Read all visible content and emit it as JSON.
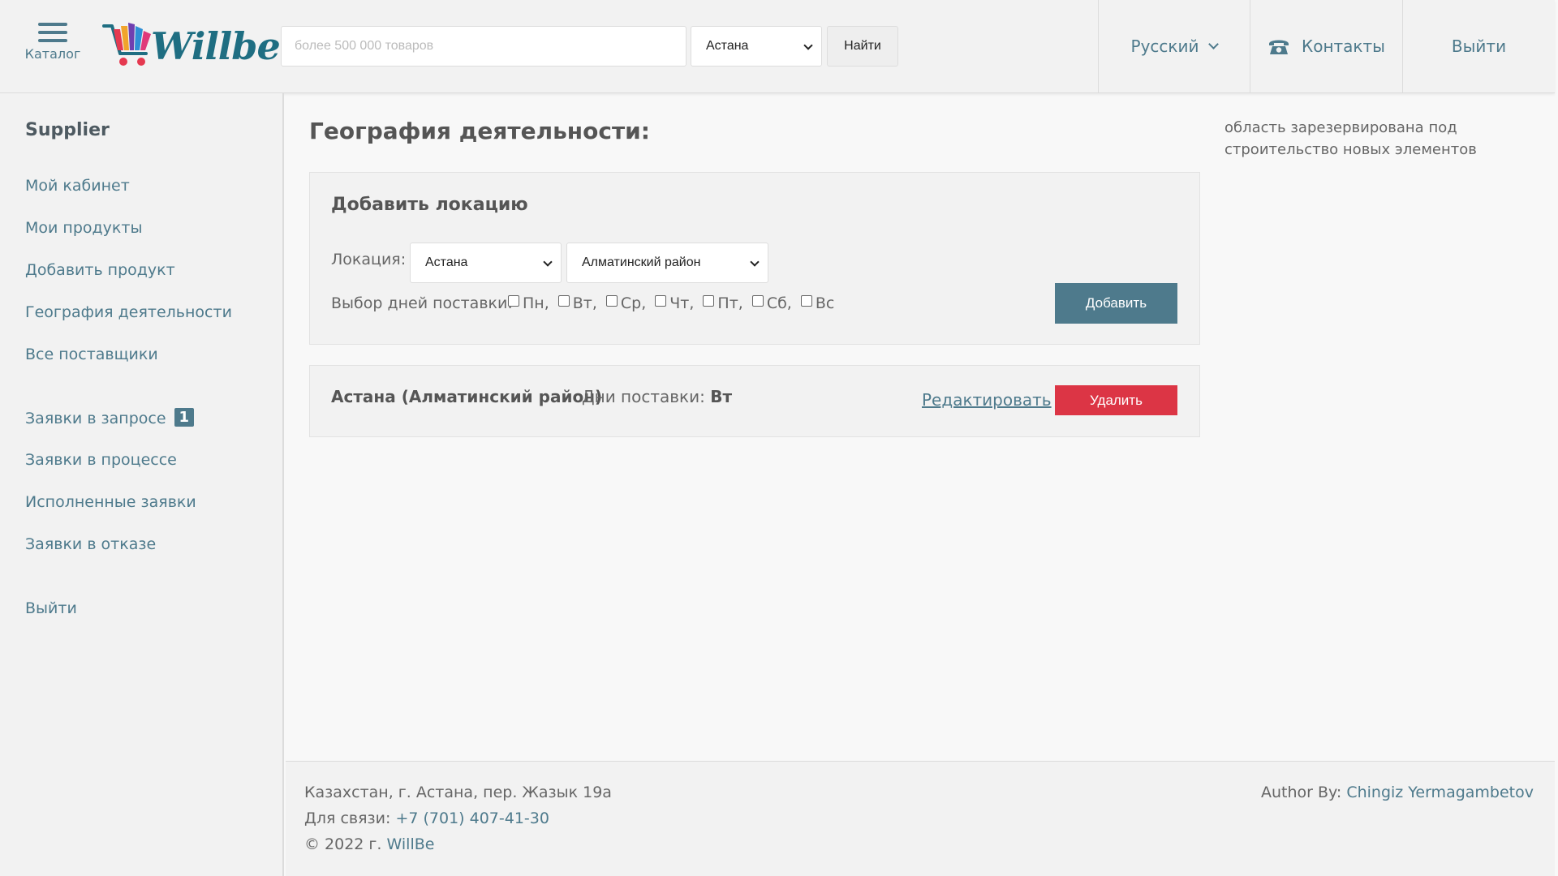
{
  "header": {
    "catalog_label": "Каталог",
    "logo_text": "Willbe",
    "search_placeholder": "более 500 000 товаров",
    "city_selected": "Астана",
    "find_label": "Найти",
    "language": "Русский",
    "contacts_label": "Контакты",
    "logout_label": "Выйти"
  },
  "sidebar": {
    "title": "Supplier",
    "items": [
      {
        "label": "Мой кабинет"
      },
      {
        "label": "Мои продукты"
      },
      {
        "label": "Добавить продукт"
      },
      {
        "label": "География деятельности"
      },
      {
        "label": "Все поставщики"
      },
      {
        "label": "Заявки в запросе",
        "badge": "1"
      },
      {
        "label": "Заявки в процессе"
      },
      {
        "label": "Исполненные заявки"
      },
      {
        "label": "Заявки в отказе"
      },
      {
        "label": "Выйти"
      }
    ]
  },
  "main": {
    "title": "География деятельности:",
    "reserved_text": "область зарезервирована под строительство новых элементов",
    "add_location": {
      "title": "Добавить локацию",
      "location_label": "Локация:",
      "city_selected": "Астана",
      "district_selected": "Алматинский район",
      "days_label": "Выбор дней поставки:",
      "days": [
        "Пн,",
        "Вт,",
        "Ср,",
        "Чт,",
        "Пт,",
        "Сб,",
        "Вс"
      ],
      "add_button": "Добавить"
    },
    "location_entry": {
      "name": "Астана (Алматинский район)",
      "days_label": "Дни поставки:",
      "days_value": "Вт",
      "edit_label": "Редактировать",
      "delete_label": "Удалить"
    }
  },
  "footer": {
    "address": "Казахстан, г. Астана, пер. Жазык 19а",
    "contact_label": "Для связи:",
    "phone": "+7 (701) 407-41-30",
    "copyright_prefix": "© 2022 г.",
    "copyright_brand": "WillBe",
    "author_label": "Author By:",
    "author_name": "Chingiz Yermagambetov"
  },
  "colors": {
    "accent": "#4e7a8c",
    "danger": "#dc3545",
    "panel": "#f2f2f2",
    "logo": "#1f6e82"
  }
}
